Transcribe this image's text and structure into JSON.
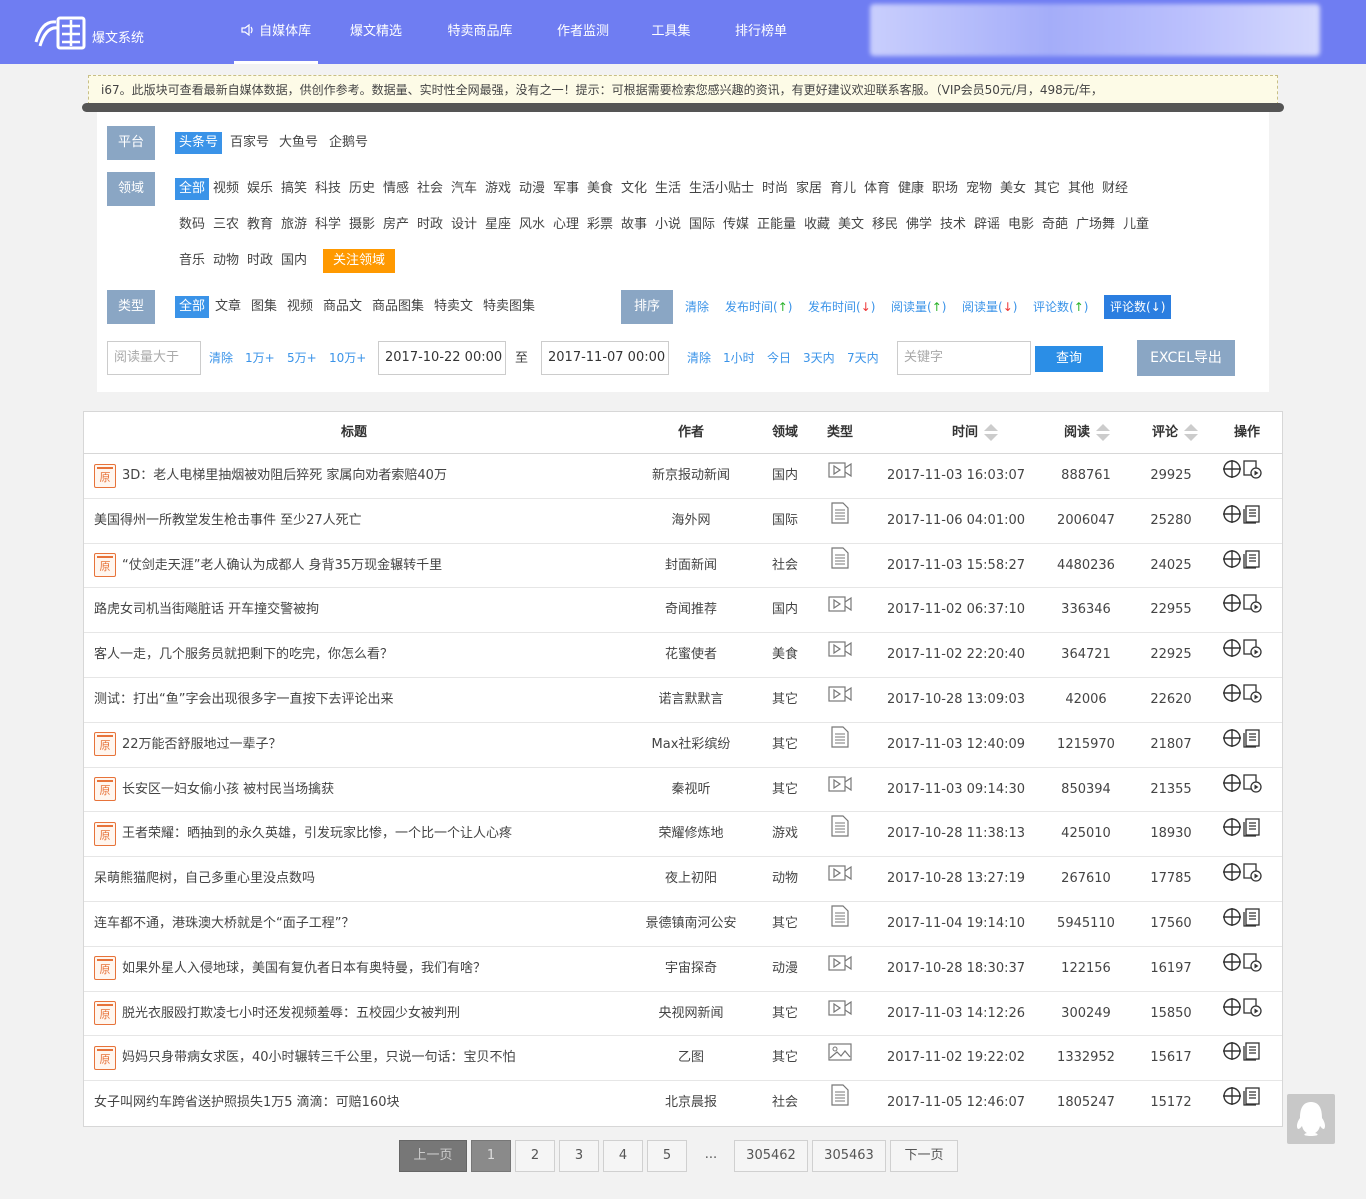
{
  "header": {
    "logo_text": "爆文系统",
    "nav": [
      {
        "label": "自媒体库",
        "active": true
      },
      {
        "label": "爆文精选"
      },
      {
        "label": "特卖商品库"
      },
      {
        "label": "作者监测"
      },
      {
        "label": "工具集"
      },
      {
        "label": "排行榜单"
      }
    ]
  },
  "notice": "i67。此版块可查看最新自媒体数据，供创作参考。数据量、实时性全网最强，没有之一！提示：可根据需要检索您感兴趣的资讯，有更好建议欢迎联系客服。（VIP会员50元/月，498元/年，",
  "filters": {
    "platform_label": "平台",
    "platforms": [
      "头条号",
      "百家号",
      "大鱼号",
      "企鹅号"
    ],
    "field_label": "领域",
    "fields_row1": [
      "全部",
      "视频",
      "娱乐",
      "搞笑",
      "科技",
      "历史",
      "情感",
      "社会",
      "汽车",
      "游戏",
      "动漫",
      "军事",
      "美食",
      "文化",
      "生活",
      "生活小贴士",
      "时尚",
      "家居",
      "育儿",
      "体育",
      "健康",
      "职场",
      "宠物",
      "美女",
      "其它",
      "其他",
      "财经"
    ],
    "fields_row2": [
      "数码",
      "三农",
      "教育",
      "旅游",
      "科学",
      "摄影",
      "房产",
      "时政",
      "设计",
      "星座",
      "风水",
      "心理",
      "彩票",
      "故事",
      "小说",
      "国际",
      "传媒",
      "正能量",
      "收藏",
      "美文",
      "移民",
      "佛学",
      "技术",
      "辟谣",
      "电影",
      "奇葩",
      "广场舞",
      "儿童"
    ],
    "fields_row3": [
      "音乐",
      "动物",
      "时政",
      "国内"
    ],
    "follow_field": "关注领域",
    "type_label": "类型",
    "types": [
      "全部",
      "文章",
      "图集",
      "视频",
      "商品文",
      "商品图集",
      "特卖文",
      "特卖图集"
    ],
    "sort_label": "排序",
    "sorts": [
      {
        "text": "清除"
      },
      {
        "text": "发布时间",
        "arrow": "↑"
      },
      {
        "text": "发布时间",
        "arrow": "↓"
      },
      {
        "text": "阅读量",
        "arrow": "↑"
      },
      {
        "text": "阅读量",
        "arrow": "↓"
      },
      {
        "text": "评论数",
        "arrow": "↑"
      },
      {
        "text": "评论数",
        "arrow": "↓",
        "active": true
      }
    ],
    "read_placeholder": "阅读量大于",
    "read_quick": [
      "清除",
      "1万+",
      "5万+",
      "10万+"
    ],
    "date_from": "2017-10-22 00:00",
    "date_sep": "至",
    "date_to": "2017-11-07 00:00",
    "time_quick": [
      "清除",
      "1小时",
      "今日",
      "3天内",
      "7天内"
    ],
    "keyword_placeholder": "关键字",
    "query_btn": "查询",
    "excel_btn": "EXCEL导出"
  },
  "table": {
    "columns": [
      "标题",
      "作者",
      "领域",
      "类型",
      "时间",
      "阅读",
      "评论",
      "操作"
    ],
    "rows": [
      {
        "orig": true,
        "title": "3D：老人电梯里抽烟被劝阻后猝死 家属向劝者索赔40万",
        "author": "新京报动新闻",
        "field": "国内",
        "type": "video",
        "time": "2017-11-03 16:03:07",
        "read": "888761",
        "comments": "29925",
        "op": "video"
      },
      {
        "orig": false,
        "title": "美国得州一所教堂发生枪击事件 至少27人死亡",
        "author": "海外网",
        "field": "国际",
        "type": "article",
        "time": "2017-11-06 04:01:00",
        "read": "2006047",
        "comments": "25280",
        "op": "doc"
      },
      {
        "orig": true,
        "title": "“仗剑走天涯”老人确认为成都人 身背35万现金辗转千里",
        "author": "封面新闻",
        "field": "社会",
        "type": "article",
        "time": "2017-11-03 15:58:27",
        "read": "4480236",
        "comments": "24025",
        "op": "doc"
      },
      {
        "orig": false,
        "title": "路虎女司机当街飚脏话 开车撞交警被拘",
        "author": "奇闻推荐",
        "field": "国内",
        "type": "video",
        "time": "2017-11-02 06:37:10",
        "read": "336346",
        "comments": "22955",
        "op": "video"
      },
      {
        "orig": false,
        "title": "客人一走，几个服务员就把剩下的吃完，你怎么看？",
        "author": "花蜜使者",
        "field": "美食",
        "type": "video",
        "time": "2017-11-02 22:20:40",
        "read": "364721",
        "comments": "22925",
        "op": "video"
      },
      {
        "orig": false,
        "title": "测试：打出“鱼”字会出现很多字一直按下去评论出来",
        "author": "诺言默默言",
        "field": "其它",
        "type": "video",
        "time": "2017-10-28 13:09:03",
        "read": "42006",
        "comments": "22620",
        "op": "video"
      },
      {
        "orig": true,
        "title": "22万能否舒服地过一辈子？",
        "author": "Max社彩缤纷",
        "field": "其它",
        "type": "article",
        "time": "2017-11-03 12:40:09",
        "read": "1215970",
        "comments": "21807",
        "op": "doc"
      },
      {
        "orig": true,
        "title": "长安区一妇女偷小孩 被村民当场擒获",
        "author": "秦视听",
        "field": "其它",
        "type": "video",
        "time": "2017-11-03 09:14:30",
        "read": "850394",
        "comments": "21355",
        "op": "video"
      },
      {
        "orig": true,
        "title": "王者荣耀：晒抽到的永久英雄，引发玩家比惨，一个比一个让人心疼",
        "author": "荣耀修炼地",
        "field": "游戏",
        "type": "article",
        "time": "2017-10-28 11:38:13",
        "read": "425010",
        "comments": "18930",
        "op": "doc"
      },
      {
        "orig": false,
        "title": "呆萌熊猫爬树，自己多重心里没点数吗",
        "author": "夜上初阳",
        "field": "动物",
        "type": "video",
        "time": "2017-10-28 13:27:19",
        "read": "267610",
        "comments": "17785",
        "op": "video"
      },
      {
        "orig": false,
        "title": "连车都不通，港珠澳大桥就是个“面子工程”？",
        "author": "景德镇南河公安",
        "field": "其它",
        "type": "article",
        "time": "2017-11-04 19:14:10",
        "read": "5945110",
        "comments": "17560",
        "op": "doc"
      },
      {
        "orig": true,
        "title": "如果外星人入侵地球，美国有复仇者日本有奥特曼，我们有啥？",
        "author": "宇宙探奇",
        "field": "动漫",
        "type": "video",
        "time": "2017-10-28 18:30:37",
        "read": "122156",
        "comments": "16197",
        "op": "video"
      },
      {
        "orig": true,
        "title": "脱光衣服殴打欺凌七小时还发视频羞辱：五校园少女被判刑",
        "author": "央视网新闻",
        "field": "其它",
        "type": "video",
        "time": "2017-11-03 14:12:26",
        "read": "300249",
        "comments": "15850",
        "op": "video"
      },
      {
        "orig": true,
        "title": "妈妈只身带病女求医，40小时辗转三千公里，只说一句话：宝贝不怕",
        "author": "乙图",
        "field": "其它",
        "type": "image",
        "time": "2017-11-02 19:22:02",
        "read": "1332952",
        "comments": "15617",
        "op": "doc"
      },
      {
        "orig": false,
        "title": "女子叫网约车跨省送护照损失1万5 滴滴：可赔160块",
        "author": "北京晨报",
        "field": "社会",
        "type": "article",
        "time": "2017-11-05 12:46:07",
        "read": "1805247",
        "comments": "15172",
        "op": "doc"
      }
    ]
  },
  "pager": {
    "prev": "上一页",
    "pages": [
      "1",
      "2",
      "3",
      "4",
      "5"
    ],
    "dots": "...",
    "last_pages": [
      "305462",
      "305463"
    ],
    "next": "下一页"
  }
}
